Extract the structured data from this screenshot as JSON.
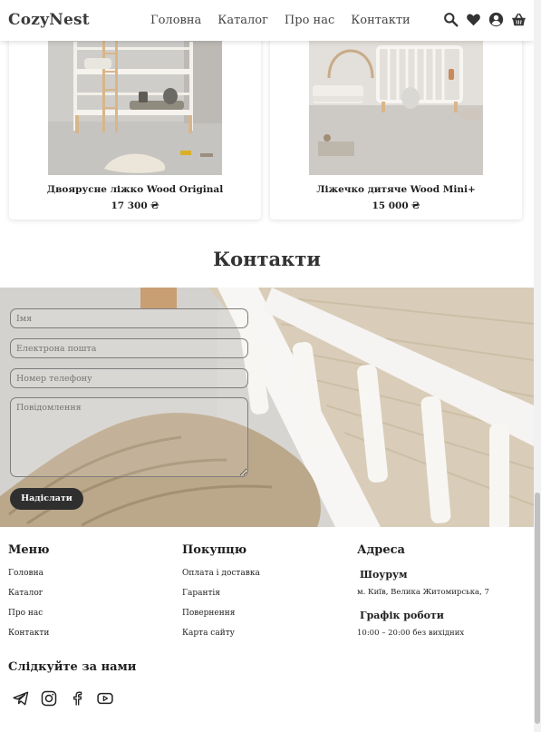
{
  "header": {
    "logo": "CozyNest",
    "nav": [
      "Головна",
      "Каталог",
      "Про нас",
      "Контакти"
    ],
    "icons": [
      "search-icon",
      "heart-icon",
      "user-icon",
      "basket-icon"
    ]
  },
  "products": [
    {
      "name": "Двоярусне ліжко Wood Original",
      "price": "17 300 ₴"
    },
    {
      "name": "Ліжечко дитяче Wood Mini+",
      "price": "15 000 ₴"
    }
  ],
  "contacts": {
    "title": "Контакти",
    "form": {
      "name_placeholder": "Імя",
      "email_placeholder": "Електрона пошта",
      "phone_placeholder": "Номер телефону",
      "message_placeholder": "Повідомлення",
      "submit_label": "Надіслати"
    }
  },
  "footer": {
    "menu": {
      "title": "Меню",
      "links": [
        "Головна",
        "Каталог",
        "Про нас",
        "Контакти"
      ]
    },
    "buyers": {
      "title": "Покупцю",
      "links": [
        "Оплата і доставка",
        "Гарантія",
        "Повернення",
        "Карта сайту"
      ]
    },
    "address": {
      "title": "Адреса",
      "showroom_label": "Шоурум",
      "showroom_address": "м. Київ, Велика Житомирська, 7",
      "hours_label": "Графік роботи",
      "hours": "10:00 – 20:00 без вихідних"
    },
    "follow_title": "Слідкуйте за нами",
    "socials": [
      "telegram-icon",
      "instagram-icon",
      "facebook-icon",
      "youtube-icon"
    ]
  },
  "colors": {
    "accent_dark": "#2f2f2f",
    "page_bg": "#ffffff"
  }
}
